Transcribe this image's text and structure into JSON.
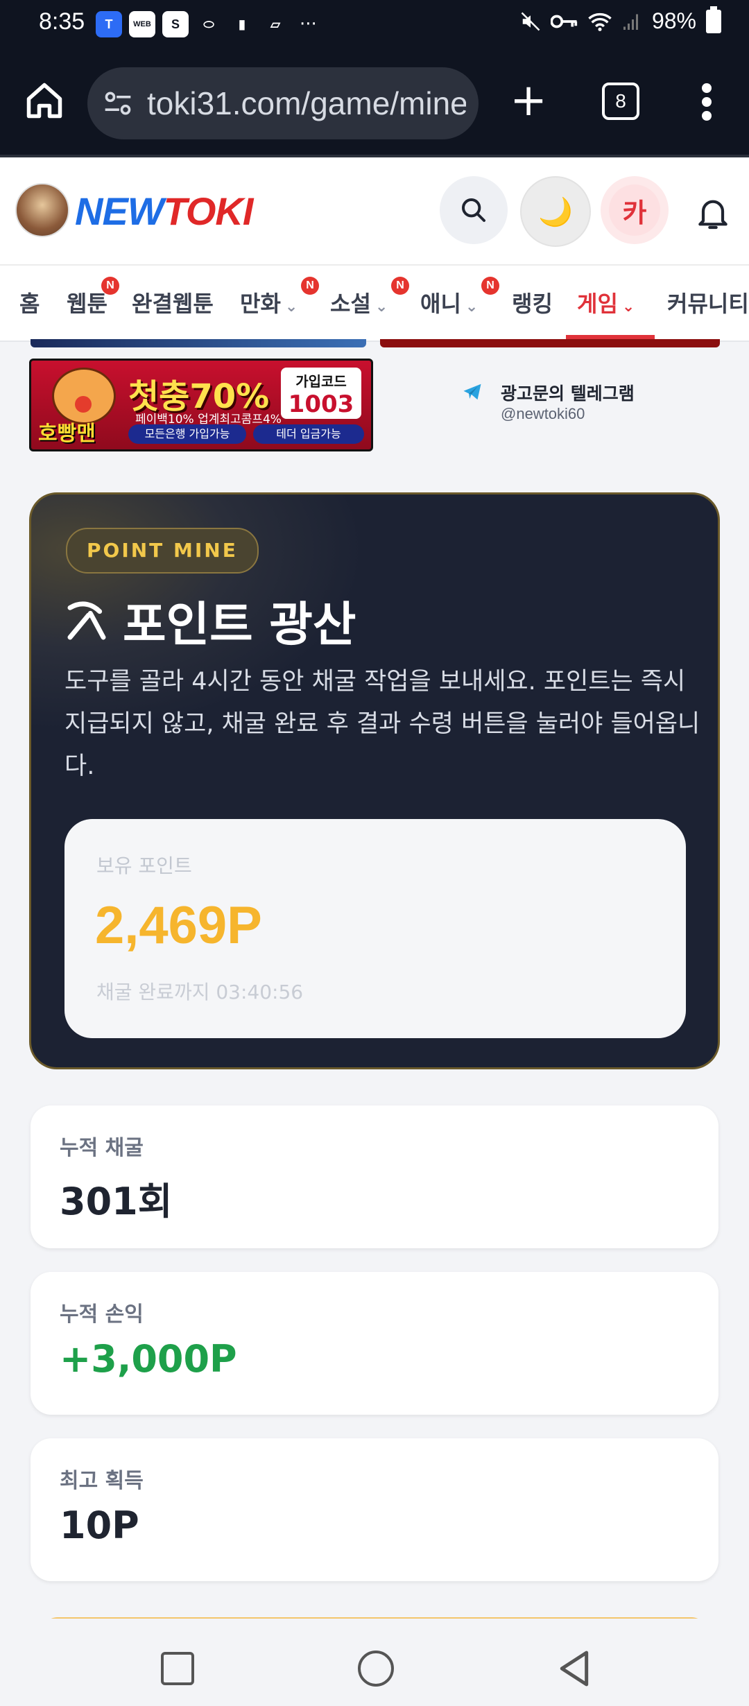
{
  "status_bar": {
    "time": "8:35",
    "left_icons": [
      "tving-icon",
      "webtoon-icon",
      "s-app-icon",
      "pill-icon",
      "battery-saver-icon",
      "no-sim-icon"
    ],
    "more": "···",
    "battery": "98%"
  },
  "browser": {
    "url": "toki31.com/game/mine",
    "tab_count": "8"
  },
  "site": {
    "logo_new": "NEW",
    "logo_toki": "TOKI",
    "moon_glyph": "🌙",
    "profile_initial": "카"
  },
  "nav": {
    "items": [
      {
        "label": "홈",
        "badge": "",
        "dropdown": false
      },
      {
        "label": "웹툰",
        "badge": "N",
        "dropdown": false
      },
      {
        "label": "완결웹툰",
        "badge": "",
        "dropdown": false
      },
      {
        "label": "만화",
        "badge": "N",
        "dropdown": true
      },
      {
        "label": "소설",
        "badge": "N",
        "dropdown": true
      },
      {
        "label": "애니",
        "badge": "N",
        "dropdown": true
      },
      {
        "label": "랭킹",
        "badge": "",
        "dropdown": false
      },
      {
        "label": "게임",
        "badge": "",
        "dropdown": true,
        "active": true
      },
      {
        "label": "커뮤니티",
        "badge": "",
        "dropdown": false
      }
    ],
    "chevron": "⌄"
  },
  "ads": {
    "banner": {
      "brand": "호빵맨",
      "headline": "첫충70%",
      "subline": "페이백10% 업계최고콤프4%",
      "code_label": "가입코드",
      "code_value": "1003",
      "pill_left": "모든은행 가입가능",
      "pill_right": "테더 입금가능"
    },
    "telegram_title": "광고문의 텔레그램",
    "telegram_handle": "@newtoki60"
  },
  "hero": {
    "badge": "POINT MINE",
    "title": "포인트 광산",
    "description": "도구를 골라 4시간 동안 채굴 작업을 보내세요. 포인트는 즉시 지급되지 않고, 채굴 완료 후 결과 수령 버튼을 눌러야 들어옵니다.",
    "points_label": "보유 포인트",
    "points_value": "2,469P",
    "timer_text": "채굴 완료까지 03:40:56"
  },
  "stats": [
    {
      "label": "누적 채굴",
      "value": "301회"
    },
    {
      "label": "누적 손익",
      "value": "+3,000P"
    },
    {
      "label": "최고 획득",
      "value": "10P"
    }
  ],
  "colors": {
    "accent_red": "#e0323a",
    "points_gold": "#f6b52d",
    "profit_green": "#1ea04a",
    "hero_bg": "#1c2233"
  }
}
